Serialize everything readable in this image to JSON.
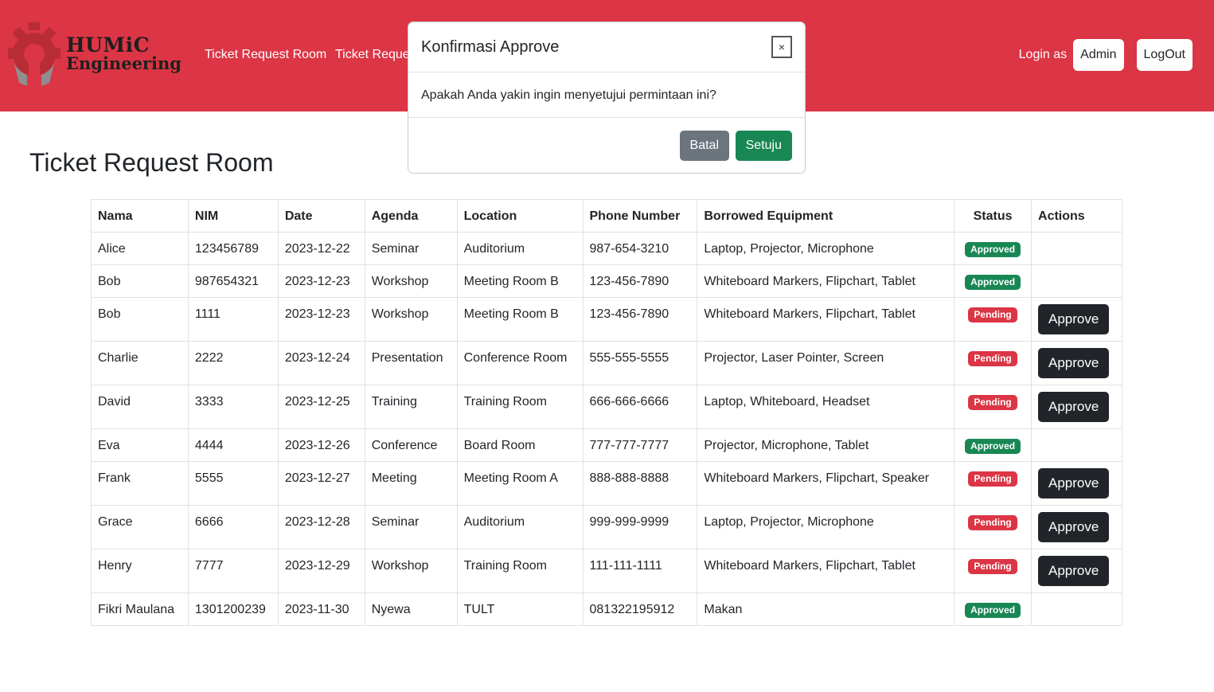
{
  "brand": {
    "logo_line1": "HUMiC",
    "logo_line2": "Engineering",
    "logo_icon": "gear-icon"
  },
  "nav": {
    "links": [
      "Ticket Request Room",
      "Ticket Reques"
    ],
    "login_as": "Login as",
    "user_button": "Admin",
    "logout_button": "LogOut"
  },
  "page": {
    "title": "Ticket Request Room"
  },
  "table": {
    "headers": [
      "Nama",
      "NIM",
      "Date",
      "Agenda",
      "Location",
      "Phone Number",
      "Borrowed Equipment",
      "Status",
      "Actions"
    ],
    "approve_label": "Approve",
    "rows": [
      {
        "nama": "Alice",
        "nim": "123456789",
        "date": "2023-12-22",
        "agenda": "Seminar",
        "location": "Auditorium",
        "phone": "987-654-3210",
        "equipment": "Laptop, Projector, Microphone",
        "status": "Approved"
      },
      {
        "nama": "Bob",
        "nim": "987654321",
        "date": "2023-12-23",
        "agenda": "Workshop",
        "location": "Meeting Room B",
        "phone": "123-456-7890",
        "equipment": "Whiteboard Markers, Flipchart, Tablet",
        "status": "Approved"
      },
      {
        "nama": "Bob",
        "nim": "1111",
        "date": "2023-12-23",
        "agenda": "Workshop",
        "location": "Meeting Room B",
        "phone": "123-456-7890",
        "equipment": "Whiteboard Markers, Flipchart, Tablet",
        "status": "Pending"
      },
      {
        "nama": "Charlie",
        "nim": "2222",
        "date": "2023-12-24",
        "agenda": "Presentation",
        "location": "Conference Room",
        "phone": "555-555-5555",
        "equipment": "Projector, Laser Pointer, Screen",
        "status": "Pending"
      },
      {
        "nama": "David",
        "nim": "3333",
        "date": "2023-12-25",
        "agenda": "Training",
        "location": "Training Room",
        "phone": "666-666-6666",
        "equipment": "Laptop, Whiteboard, Headset",
        "status": "Pending"
      },
      {
        "nama": "Eva",
        "nim": "4444",
        "date": "2023-12-26",
        "agenda": "Conference",
        "location": "Board Room",
        "phone": "777-777-7777",
        "equipment": "Projector, Microphone, Tablet",
        "status": "Approved"
      },
      {
        "nama": "Frank",
        "nim": "5555",
        "date": "2023-12-27",
        "agenda": "Meeting",
        "location": "Meeting Room A",
        "phone": "888-888-8888",
        "equipment": "Whiteboard Markers, Flipchart, Speaker",
        "status": "Pending"
      },
      {
        "nama": "Grace",
        "nim": "6666",
        "date": "2023-12-28",
        "agenda": "Seminar",
        "location": "Auditorium",
        "phone": "999-999-9999",
        "equipment": "Laptop, Projector, Microphone",
        "status": "Pending"
      },
      {
        "nama": "Henry",
        "nim": "7777",
        "date": "2023-12-29",
        "agenda": "Workshop",
        "location": "Training Room",
        "phone": "111-111-1111",
        "equipment": "Whiteboard Markers, Flipchart, Tablet",
        "status": "Pending"
      },
      {
        "nama": "Fikri Maulana",
        "nim": "1301200239",
        "date": "2023-11-30",
        "agenda": "Nyewa",
        "location": "TULT",
        "phone": "081322195912",
        "equipment": "Makan",
        "status": "Approved"
      }
    ]
  },
  "modal": {
    "title": "Konfirmasi Approve",
    "close_label": "×",
    "message": "Apakah Anda yakin ingin menyetujui permintaan ini?",
    "cancel_label": "Batal",
    "confirm_label": "Setuju"
  },
  "colors": {
    "navbar": "#dc3545",
    "approved": "#198754",
    "pending": "#dc3545",
    "approve_button": "#212529",
    "cancel_button": "#6c757d"
  }
}
